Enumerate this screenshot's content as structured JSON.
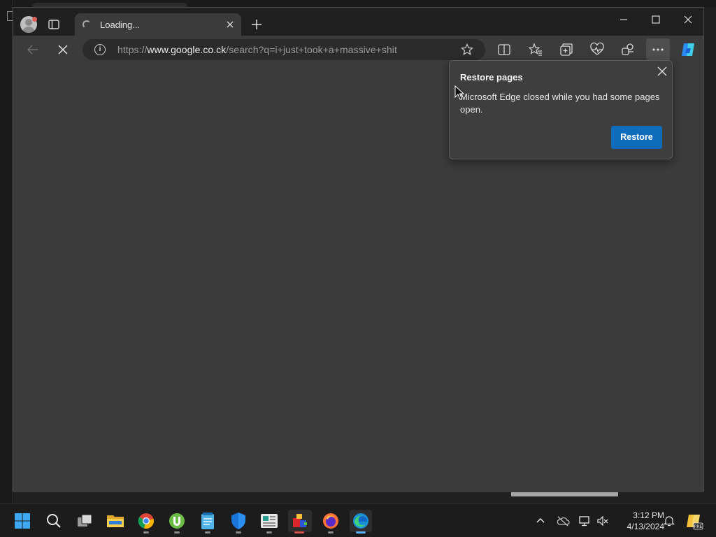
{
  "browser": {
    "tab": {
      "title": "Loading..."
    },
    "address_bar": {
      "url_scheme": "https://",
      "url_host": "www.google.co.ck",
      "url_path": "/search?q=i+just+took+a+massive+shit"
    }
  },
  "restore_popup": {
    "title": "Restore pages",
    "message": "Microsoft Edge closed while you had some pages open.",
    "button_label": "Restore"
  },
  "taskbar": {
    "apps": [
      "start",
      "search",
      "task-view",
      "file-explorer",
      "chrome",
      "utorrent",
      "notepad",
      "windows-security",
      "news",
      "app-red",
      "firefox",
      "edge"
    ],
    "clock": {
      "time": "3:12 PM",
      "date": "4/13/2024"
    }
  },
  "colors": {
    "accent": "#0f6cbd",
    "window_bg": "#3b3b3b",
    "titlebar_bg": "#202020",
    "taskbar_bg": "#1c1c1c"
  }
}
